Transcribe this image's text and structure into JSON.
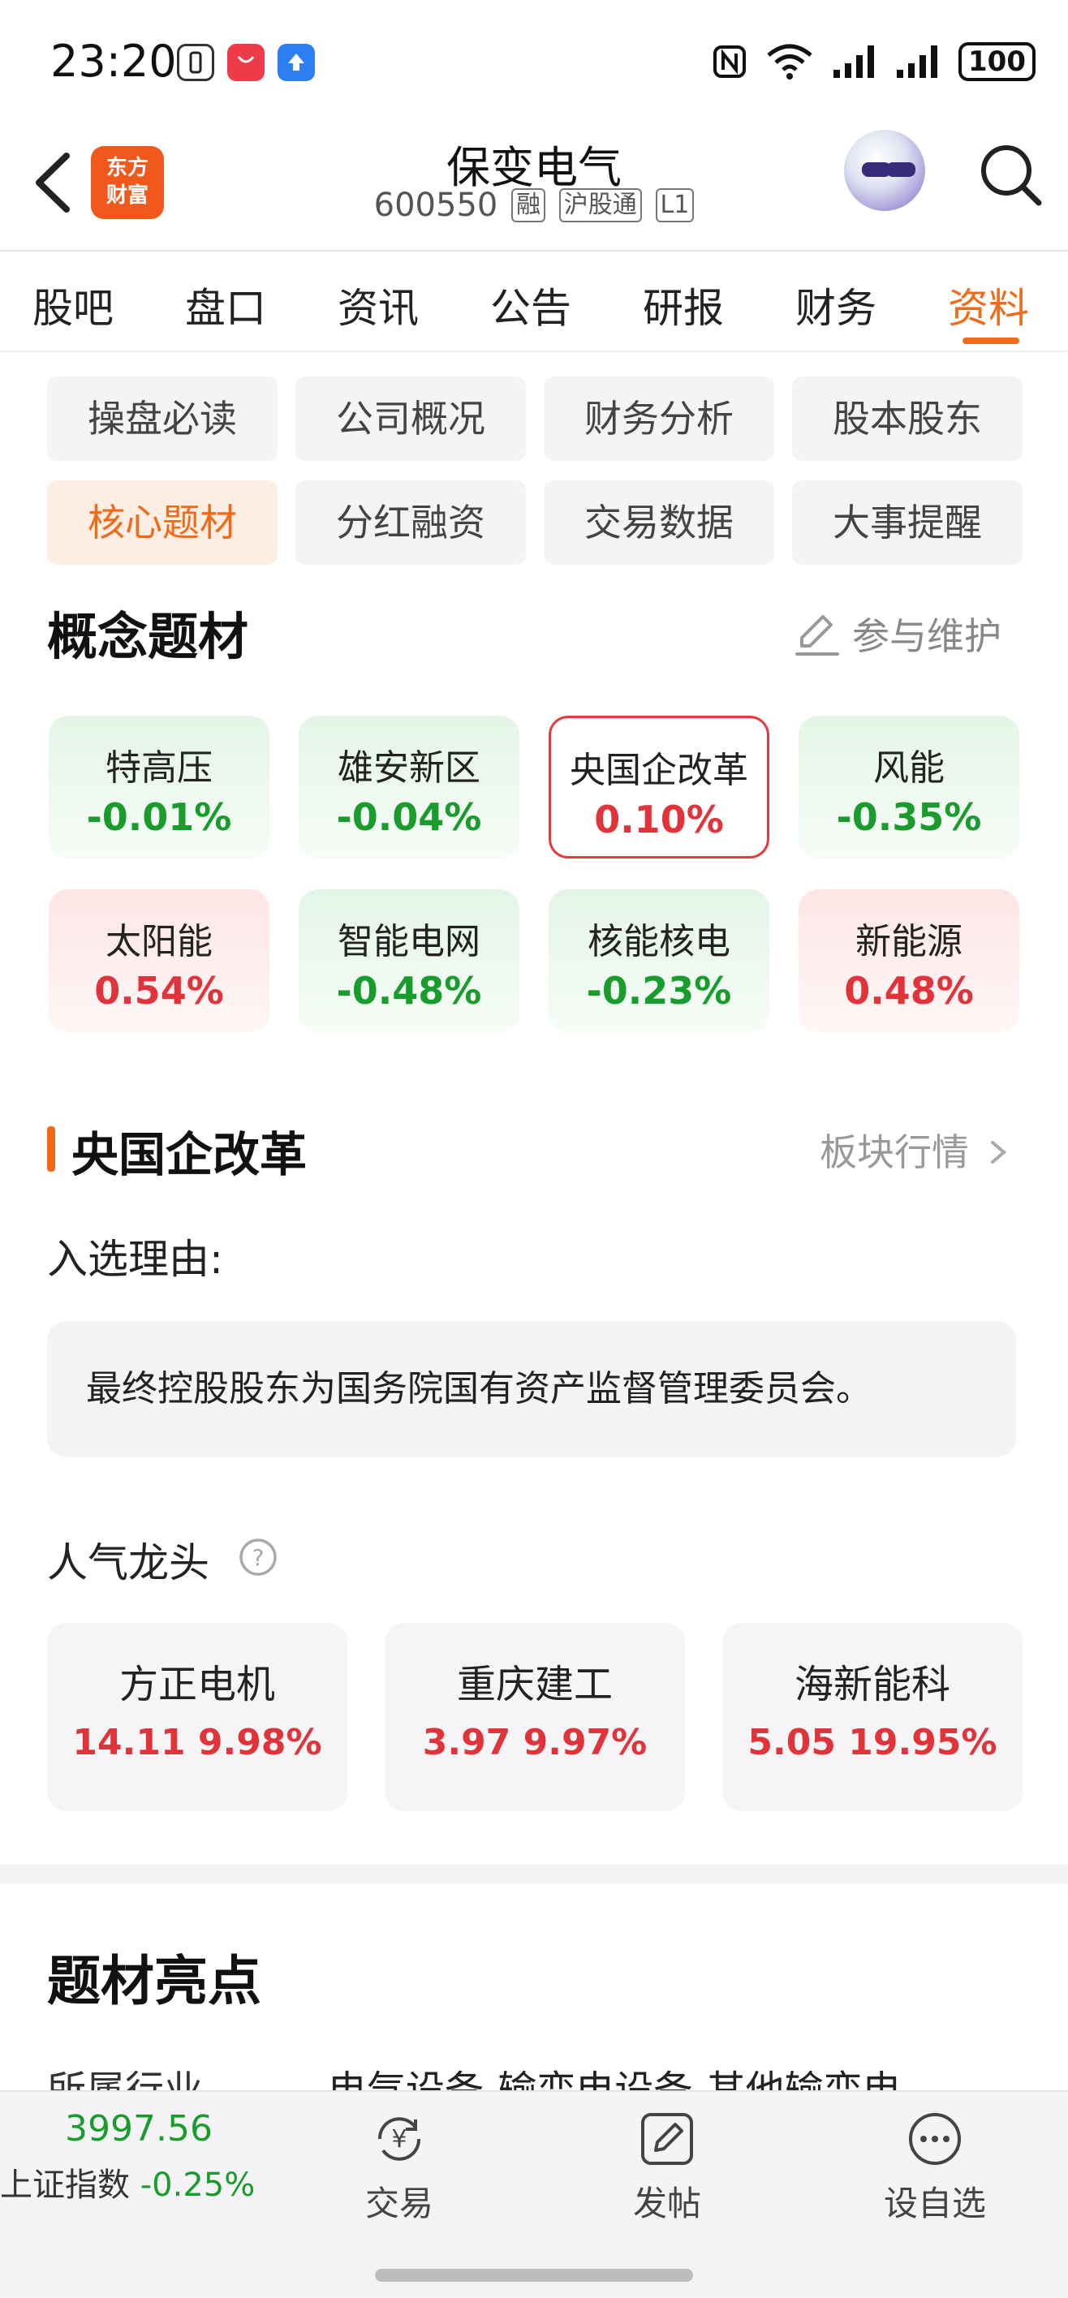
{
  "status_bar": {
    "time": "23:20",
    "battery": "100",
    "icons": [
      "vibrate-icon",
      "app-gallery-icon",
      "upload-icon",
      "nfc-icon",
      "wifi-icon",
      "signal-icon",
      "signal-icon-2",
      "battery-icon"
    ]
  },
  "header": {
    "logo_line1": "东方",
    "logo_line2": "财富",
    "stock_name": "保变电气",
    "stock_code": "600550",
    "tags": [
      "融",
      "沪股通",
      "L1"
    ]
  },
  "tabs": [
    {
      "label": "股吧"
    },
    {
      "label": "盘口"
    },
    {
      "label": "资讯"
    },
    {
      "label": "公告"
    },
    {
      "label": "研报"
    },
    {
      "label": "财务"
    },
    {
      "label": "资料",
      "active": true
    }
  ],
  "sub_tabs": [
    {
      "label": "操盘必读"
    },
    {
      "label": "公司概况"
    },
    {
      "label": "财务分析"
    },
    {
      "label": "股本股东"
    },
    {
      "label": "核心题材",
      "active": true
    },
    {
      "label": "分红融资"
    },
    {
      "label": "交易数据"
    },
    {
      "label": "大事提醒"
    }
  ],
  "concepts_section": {
    "title": "概念题材",
    "maintain_label": "参与维护",
    "items": [
      {
        "name": "特高压",
        "change": "-0.01%",
        "direction": "down"
      },
      {
        "name": "雄安新区",
        "change": "-0.04%",
        "direction": "down"
      },
      {
        "name": "央国企改革",
        "change": "0.10%",
        "direction": "up",
        "selected": true
      },
      {
        "name": "风能",
        "change": "-0.35%",
        "direction": "down"
      },
      {
        "name": "太阳能",
        "change": "0.54%",
        "direction": "up"
      },
      {
        "name": "智能电网",
        "change": "-0.48%",
        "direction": "down"
      },
      {
        "name": "核能核电",
        "change": "-0.23%",
        "direction": "down"
      },
      {
        "name": "新能源",
        "change": "0.48%",
        "direction": "up"
      }
    ]
  },
  "detail": {
    "title": "央国企改革",
    "sector_link": "板块行情",
    "reason_label": "入选理由:",
    "reason_text": "最终控股股东为国务院国有资产监督管理委员会。",
    "leaders_label": "人气龙头",
    "leaders": [
      {
        "name": "方正电机",
        "value": "14.11 9.98%"
      },
      {
        "name": "重庆建工",
        "value": "3.97 9.97%"
      },
      {
        "name": "海新能科",
        "value": "5.05 19.95%"
      }
    ]
  },
  "highlights": {
    "title": "题材亮点",
    "industry_label": "所属行业",
    "industry_value": "电气设备-输变电设备-其他输变电"
  },
  "bottom_bar": {
    "index_value": "3997.56",
    "index_label": "上证指数",
    "index_change": "-0.25%",
    "trade_label": "交易",
    "post_label": "发帖",
    "watchlist_label": "设自选"
  },
  "colors": {
    "accent": "#f06a19",
    "up": "#e0333a",
    "down": "#1a9c2c"
  }
}
